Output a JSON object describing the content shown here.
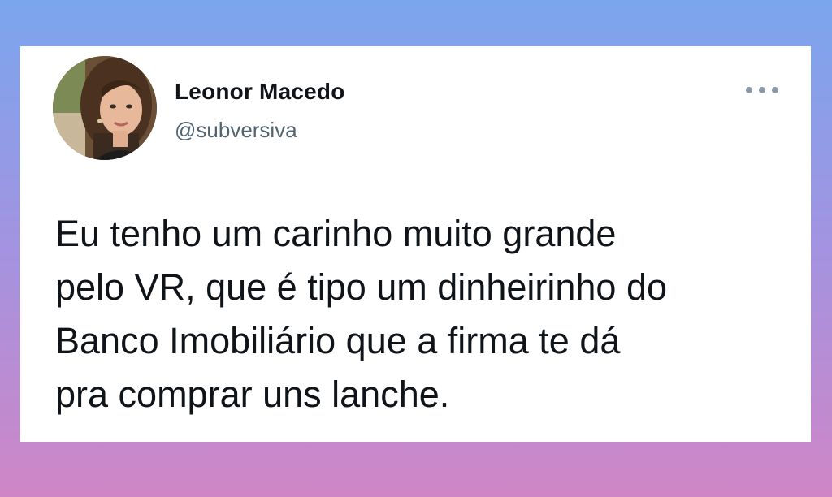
{
  "tweet": {
    "author": {
      "name": "Leonor Macedo",
      "handle": "@subversiva",
      "avatar_icon": "profile-photo"
    },
    "more_icon": "ellipsis-icon",
    "text_lines": [
      "Eu tenho um carinho muito grande",
      "pelo VR, que é tipo um dinheirinho do",
      "Banco Imobiliário que a firma te dá",
      "pra comprar uns lanche."
    ]
  },
  "colors": {
    "background_top": "#7aa6ee",
    "background_bottom": "#cf86c6",
    "card": "#ffffff",
    "text": "#0f1419",
    "muted": "#536471"
  }
}
